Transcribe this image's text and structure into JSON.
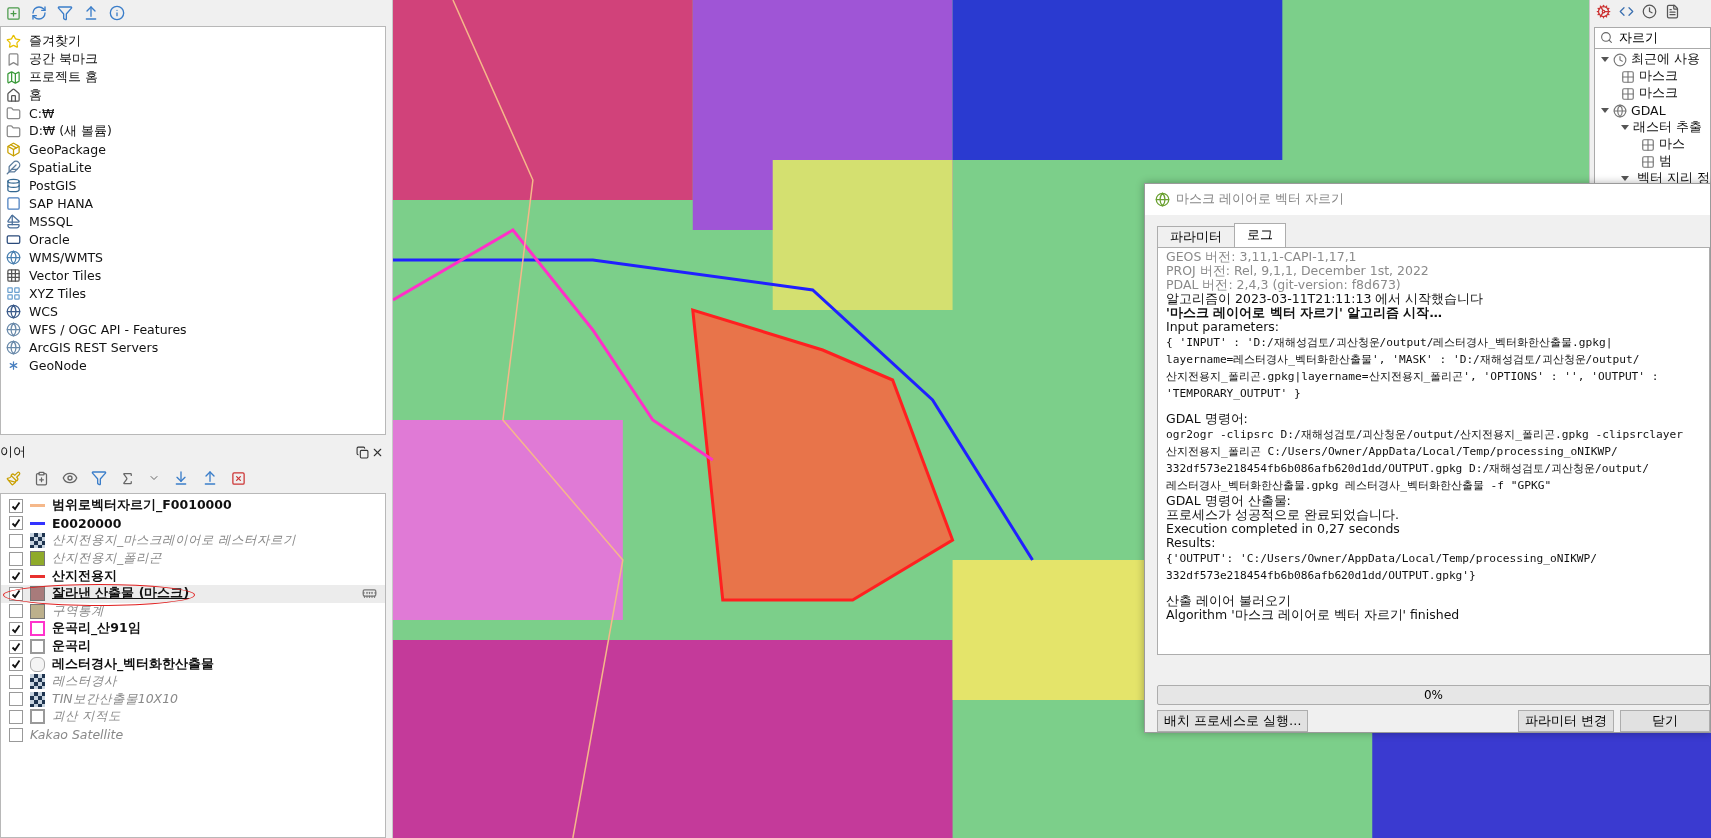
{
  "browser": {
    "items": [
      {
        "label": "즐겨찾기"
      },
      {
        "label": "공간 북마크"
      },
      {
        "label": "프로젝트 홈"
      },
      {
        "label": "홈"
      },
      {
        "label": "C:₩"
      },
      {
        "label": "D:₩ (새 볼륨)"
      },
      {
        "label": "GeoPackage"
      },
      {
        "label": "SpatiaLite"
      },
      {
        "label": "PostGIS"
      },
      {
        "label": "SAP HANA"
      },
      {
        "label": "MSSQL"
      },
      {
        "label": "Oracle"
      },
      {
        "label": "WMS/WMTS"
      },
      {
        "label": "Vector Tiles"
      },
      {
        "label": "XYZ Tiles"
      },
      {
        "label": "WCS"
      },
      {
        "label": "WFS / OGC API - Features"
      },
      {
        "label": "ArcGIS REST Servers"
      },
      {
        "label": "GeoNode"
      }
    ]
  },
  "layers_panel": {
    "title": "이어",
    "layers": [
      {
        "label": "범위로벡터자르기_F0010000",
        "checked": true,
        "selected": false,
        "kind": "line",
        "color": "#f5b88a"
      },
      {
        "label": "E0020000",
        "checked": true,
        "selected": false,
        "kind": "line",
        "color": "#3333ff"
      },
      {
        "label": "산지전용지_마스크레이어로 레스터자르기",
        "checked": false,
        "selected": false,
        "kind": "raster"
      },
      {
        "label": "산지전용지_폴리곤",
        "checked": false,
        "selected": false,
        "kind": "fill",
        "color": "#8faa2a"
      },
      {
        "label": "산지전용지",
        "checked": true,
        "selected": false,
        "kind": "line",
        "color": "#e8312f"
      },
      {
        "label": "잘라낸 산출물 (마스크)",
        "checked": true,
        "selected": true,
        "kind": "fill",
        "color": "#a87b7b"
      },
      {
        "label": "구역통계",
        "checked": false,
        "selected": false,
        "kind": "fill",
        "color": "#bcb08c"
      },
      {
        "label": "운곡리_산91임",
        "checked": true,
        "selected": false,
        "kind": "outline",
        "color": "#ff33cc"
      },
      {
        "label": "운곡리",
        "checked": true,
        "selected": false,
        "kind": "outline",
        "color": "#9a9a9a"
      },
      {
        "label": "레스터경사_벡터화한산출물",
        "checked": true,
        "selected": false,
        "kind": "blob"
      },
      {
        "label": "레스터경사",
        "checked": false,
        "selected": false,
        "kind": "raster"
      },
      {
        "label": "TIN보간산출물10X10",
        "checked": false,
        "selected": false,
        "kind": "raster"
      },
      {
        "label": "괴산 지적도",
        "checked": false,
        "selected": false,
        "kind": "outline",
        "color": "#9a9a9a"
      },
      {
        "label": "Kakao Satellite",
        "checked": false,
        "selected": false,
        "kind": "none"
      }
    ]
  },
  "toolbox": {
    "search": {
      "value": "자르기"
    },
    "tree": [
      {
        "label": "최근에 사용",
        "expanded": true,
        "children": [
          {
            "label": "마스크"
          },
          {
            "label": "마스크"
          }
        ]
      },
      {
        "label": "GDAL",
        "expanded": true,
        "children": [
          {
            "label": "래스터 추출",
            "expanded": true,
            "children": [
              {
                "label": "마스"
              },
              {
                "label": "범"
              }
            ]
          },
          {
            "label": "벡터 지리 정",
            "expanded": true
          }
        ]
      }
    ]
  },
  "dialog": {
    "title": "마스크 레이어로 벡터 자르기",
    "tabs": [
      {
        "label": "파라미터",
        "selected": false
      },
      {
        "label": "로그",
        "selected": true
      }
    ],
    "log": [
      {
        "kind": "dim",
        "text": "GEOS 버전: 3,11,1-CAPI-1,17,1"
      },
      {
        "kind": "dim",
        "text": "PROJ 버전: Rel, 9,1,1, December 1st, 2022"
      },
      {
        "kind": "dim",
        "text": "PDAL 버전: 2,4,3 (git-version: f8d673)"
      },
      {
        "kind": "plain",
        "text": "알고리즘이 2023-03-11T21:11:13 에서 시작했습니다"
      },
      {
        "kind": "bold",
        "text": "'마스크 레이어로 벡터 자르기' 알고리즘 시작…"
      },
      {
        "kind": "plain",
        "text": "Input parameters:"
      },
      {
        "kind": "code",
        "text": "{ 'INPUT' : 'D:/재해성검토/괴산청운/output/레스터경사_벡터화한산출물.gpkg|"
      },
      {
        "kind": "code",
        "text": "layername=레스터경사_벡터화한산출물', 'MASK' : 'D:/재해성검토/괴산청운/output/"
      },
      {
        "kind": "code",
        "text": "산지전용지_폴리곤.gpkg|layername=산지전용지_폴리곤', 'OPTIONS' : '', 'OUTPUT' :"
      },
      {
        "kind": "code",
        "text": "'TEMPORARY_OUTPUT' }"
      },
      {
        "kind": "gap"
      },
      {
        "kind": "plain",
        "text": "GDAL 명령어:"
      },
      {
        "kind": "code",
        "text": "ogr2ogr -clipsrc D:/재해성검토/괴산청운/output/산지전용지_폴리곤.gpkg -clipsrclayer"
      },
      {
        "kind": "code",
        "text": "산지전용지_폴리곤 C:/Users/Owner/AppData/Local/Temp/processing_oNIKWP/"
      },
      {
        "kind": "code",
        "text": "332df573e218454fb6b086afb620d1dd/OUTPUT.gpkg D:/재해성검토/괴산청운/output/"
      },
      {
        "kind": "code",
        "text": "레스터경사_벡터화한산출물.gpkg 레스터경사_벡터화한산출물 -f \"GPKG\""
      },
      {
        "kind": "plain",
        "text": "GDAL 명령어 산출물:"
      },
      {
        "kind": "plain",
        "text": "프로세스가 성공적으로 완료되었습니다."
      },
      {
        "kind": "plain",
        "text": "Execution completed in 0,27 seconds"
      },
      {
        "kind": "plain",
        "text": "Results:"
      },
      {
        "kind": "code",
        "text": "{'OUTPUT': 'C:/Users/Owner/AppData/Local/Temp/processing_oNIKWP/"
      },
      {
        "kind": "code",
        "text": "332df573e218454fb6b086afb620d1dd/OUTPUT.gpkg'}"
      },
      {
        "kind": "gap"
      },
      {
        "kind": "plain",
        "text": "산출 레이어 불러오기"
      },
      {
        "kind": "plain",
        "text": "Algorithm '마스크 레이어로 벡터 자르기' finished"
      }
    ],
    "progress": {
      "text": "0%"
    },
    "buttons": [
      "배치 프로세스로 실행…",
      "파라미터 변경",
      "닫기"
    ]
  }
}
